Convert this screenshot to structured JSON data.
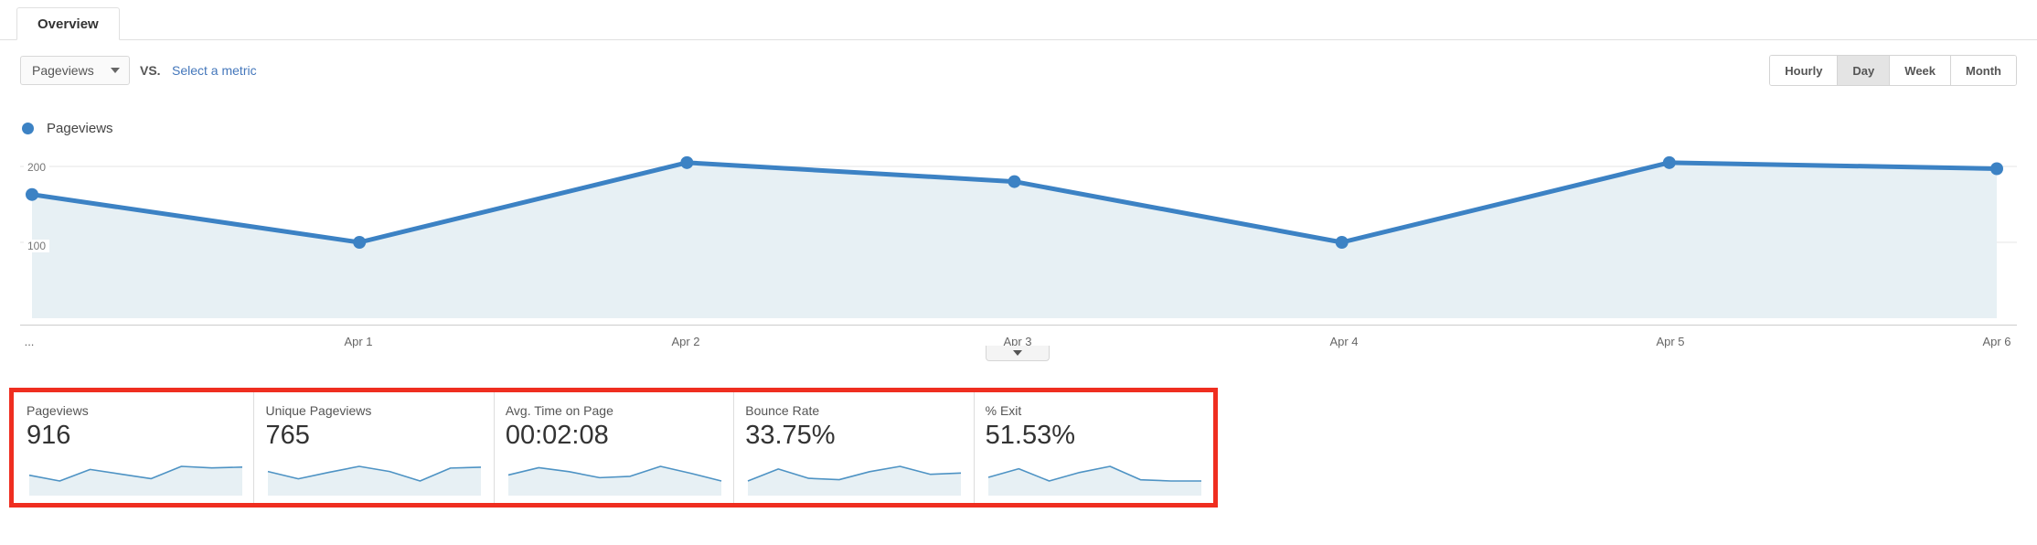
{
  "tab": {
    "label": "Overview"
  },
  "controls": {
    "metric_selected": "Pageviews",
    "vs_label": "VS.",
    "compare_link": "Select a metric",
    "dropdown_icon": "chevron-down-icon",
    "granularity": {
      "options": [
        "Hourly",
        "Day",
        "Week",
        "Month"
      ],
      "selected": "Day"
    }
  },
  "legend": [
    {
      "label": "Pageviews",
      "color": "#3c82c4"
    }
  ],
  "chart_data": {
    "type": "line",
    "title": "Pageviews",
    "xlabel": "",
    "ylabel": "",
    "grid": true,
    "legend_position": "top-left",
    "ylim": [
      0,
      200
    ],
    "yticks": [
      200,
      100
    ],
    "categories": [
      "...",
      "Apr 1",
      "Apr 2",
      "Apr 3",
      "Apr 4",
      "Apr 5",
      "Apr 6"
    ],
    "series": [
      {
        "name": "Pageviews",
        "color": "#3c82c4",
        "fill": "#e7f0f4",
        "values": [
          163,
          100,
          205,
          180,
          100,
          205,
          197
        ]
      }
    ]
  },
  "collapse_control": {
    "icon": "chevron-down-icon"
  },
  "metric_cards": {
    "highlight_color": "#ef2e20",
    "items": [
      {
        "title": "Pageviews",
        "value": "916",
        "spark": [
          55,
          40,
          70,
          58,
          46,
          78,
          74,
          76
        ]
      },
      {
        "title": "Unique Pageviews",
        "value": "765",
        "spark": [
          62,
          45,
          60,
          74,
          62,
          40,
          70,
          72
        ]
      },
      {
        "title": "Avg. Time on Page",
        "value": "00:02:08",
        "spark": [
          50,
          72,
          60,
          42,
          46,
          76,
          55,
          32
        ]
      },
      {
        "title": "Bounce Rate",
        "value": "33.75%",
        "spark": [
          48,
          66,
          52,
          50,
          62,
          70,
          58,
          60
        ]
      },
      {
        "title": "% Exit",
        "value": "51.53%",
        "spark": [
          58,
          72,
          52,
          66,
          76,
          54,
          52,
          52
        ]
      }
    ]
  }
}
